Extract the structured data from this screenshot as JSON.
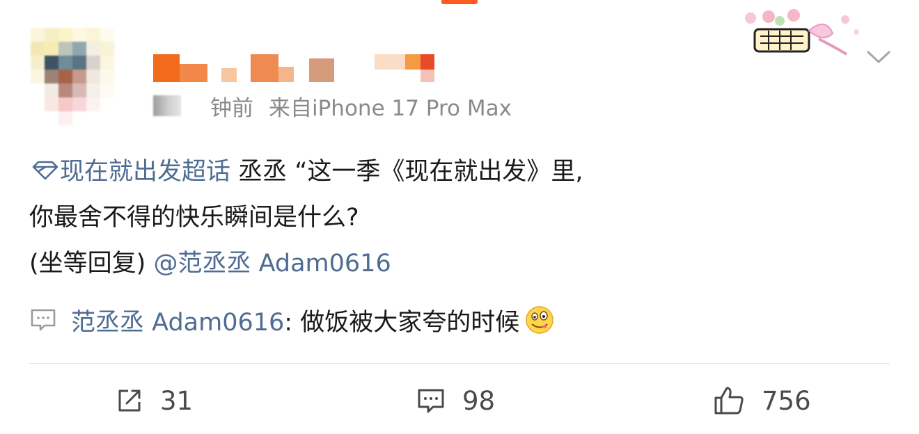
{
  "post": {
    "time_suffix": "钟前",
    "source": "来自iPhone 17 Pro Max",
    "topic": "现在就出发超话",
    "line1_text": " 丞丞 “这一季《现在就出发》里,",
    "line2_text": "你最舍不得的快乐瞬间是什么?",
    "line3_prefix": "(坐等回复) ",
    "mention": "@范丞丞 Adam0616"
  },
  "reply": {
    "author": "范丞丞 Adam0616",
    "text": ": 做饭被大家夸的时候",
    "emoji_icon": "drooling-face-emoji"
  },
  "actions": {
    "share_count": "31",
    "comment_count": "98",
    "like_count": "756"
  },
  "colors": {
    "link_blue": "#4f6c92",
    "accent_orange": "#ff5a1f",
    "meta_gray": "#8a8a8a"
  }
}
